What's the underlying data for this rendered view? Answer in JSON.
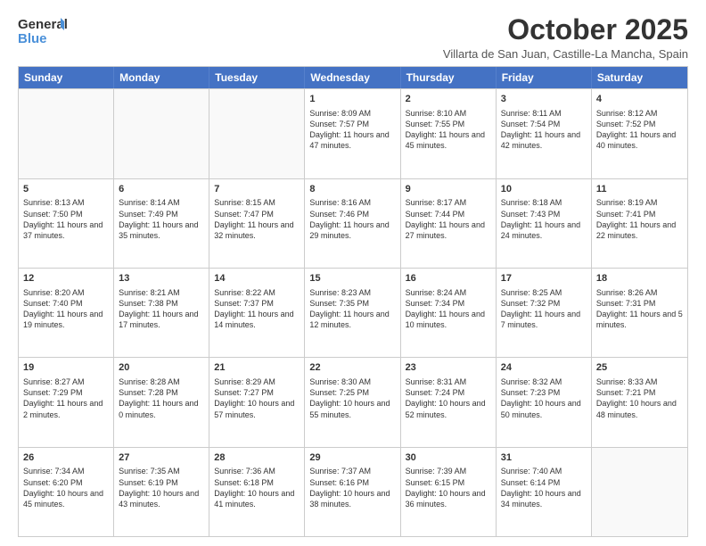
{
  "logo": {
    "line1": "General",
    "line2": "Blue"
  },
  "header": {
    "title": "October 2025",
    "location": "Villarta de San Juan, Castille-La Mancha, Spain"
  },
  "calendar": {
    "days": [
      "Sunday",
      "Monday",
      "Tuesday",
      "Wednesday",
      "Thursday",
      "Friday",
      "Saturday"
    ],
    "rows": [
      [
        {
          "day": "",
          "content": ""
        },
        {
          "day": "",
          "content": ""
        },
        {
          "day": "",
          "content": ""
        },
        {
          "day": "1",
          "content": "Sunrise: 8:09 AM\nSunset: 7:57 PM\nDaylight: 11 hours and 47 minutes."
        },
        {
          "day": "2",
          "content": "Sunrise: 8:10 AM\nSunset: 7:55 PM\nDaylight: 11 hours and 45 minutes."
        },
        {
          "day": "3",
          "content": "Sunrise: 8:11 AM\nSunset: 7:54 PM\nDaylight: 11 hours and 42 minutes."
        },
        {
          "day": "4",
          "content": "Sunrise: 8:12 AM\nSunset: 7:52 PM\nDaylight: 11 hours and 40 minutes."
        }
      ],
      [
        {
          "day": "5",
          "content": "Sunrise: 8:13 AM\nSunset: 7:50 PM\nDaylight: 11 hours and 37 minutes."
        },
        {
          "day": "6",
          "content": "Sunrise: 8:14 AM\nSunset: 7:49 PM\nDaylight: 11 hours and 35 minutes."
        },
        {
          "day": "7",
          "content": "Sunrise: 8:15 AM\nSunset: 7:47 PM\nDaylight: 11 hours and 32 minutes."
        },
        {
          "day": "8",
          "content": "Sunrise: 8:16 AM\nSunset: 7:46 PM\nDaylight: 11 hours and 29 minutes."
        },
        {
          "day": "9",
          "content": "Sunrise: 8:17 AM\nSunset: 7:44 PM\nDaylight: 11 hours and 27 minutes."
        },
        {
          "day": "10",
          "content": "Sunrise: 8:18 AM\nSunset: 7:43 PM\nDaylight: 11 hours and 24 minutes."
        },
        {
          "day": "11",
          "content": "Sunrise: 8:19 AM\nSunset: 7:41 PM\nDaylight: 11 hours and 22 minutes."
        }
      ],
      [
        {
          "day": "12",
          "content": "Sunrise: 8:20 AM\nSunset: 7:40 PM\nDaylight: 11 hours and 19 minutes."
        },
        {
          "day": "13",
          "content": "Sunrise: 8:21 AM\nSunset: 7:38 PM\nDaylight: 11 hours and 17 minutes."
        },
        {
          "day": "14",
          "content": "Sunrise: 8:22 AM\nSunset: 7:37 PM\nDaylight: 11 hours and 14 minutes."
        },
        {
          "day": "15",
          "content": "Sunrise: 8:23 AM\nSunset: 7:35 PM\nDaylight: 11 hours and 12 minutes."
        },
        {
          "day": "16",
          "content": "Sunrise: 8:24 AM\nSunset: 7:34 PM\nDaylight: 11 hours and 10 minutes."
        },
        {
          "day": "17",
          "content": "Sunrise: 8:25 AM\nSunset: 7:32 PM\nDaylight: 11 hours and 7 minutes."
        },
        {
          "day": "18",
          "content": "Sunrise: 8:26 AM\nSunset: 7:31 PM\nDaylight: 11 hours and 5 minutes."
        }
      ],
      [
        {
          "day": "19",
          "content": "Sunrise: 8:27 AM\nSunset: 7:29 PM\nDaylight: 11 hours and 2 minutes."
        },
        {
          "day": "20",
          "content": "Sunrise: 8:28 AM\nSunset: 7:28 PM\nDaylight: 11 hours and 0 minutes."
        },
        {
          "day": "21",
          "content": "Sunrise: 8:29 AM\nSunset: 7:27 PM\nDaylight: 10 hours and 57 minutes."
        },
        {
          "day": "22",
          "content": "Sunrise: 8:30 AM\nSunset: 7:25 PM\nDaylight: 10 hours and 55 minutes."
        },
        {
          "day": "23",
          "content": "Sunrise: 8:31 AM\nSunset: 7:24 PM\nDaylight: 10 hours and 52 minutes."
        },
        {
          "day": "24",
          "content": "Sunrise: 8:32 AM\nSunset: 7:23 PM\nDaylight: 10 hours and 50 minutes."
        },
        {
          "day": "25",
          "content": "Sunrise: 8:33 AM\nSunset: 7:21 PM\nDaylight: 10 hours and 48 minutes."
        }
      ],
      [
        {
          "day": "26",
          "content": "Sunrise: 7:34 AM\nSunset: 6:20 PM\nDaylight: 10 hours and 45 minutes."
        },
        {
          "day": "27",
          "content": "Sunrise: 7:35 AM\nSunset: 6:19 PM\nDaylight: 10 hours and 43 minutes."
        },
        {
          "day": "28",
          "content": "Sunrise: 7:36 AM\nSunset: 6:18 PM\nDaylight: 10 hours and 41 minutes."
        },
        {
          "day": "29",
          "content": "Sunrise: 7:37 AM\nSunset: 6:16 PM\nDaylight: 10 hours and 38 minutes."
        },
        {
          "day": "30",
          "content": "Sunrise: 7:39 AM\nSunset: 6:15 PM\nDaylight: 10 hours and 36 minutes."
        },
        {
          "day": "31",
          "content": "Sunrise: 7:40 AM\nSunset: 6:14 PM\nDaylight: 10 hours and 34 minutes."
        },
        {
          "day": "",
          "content": ""
        }
      ]
    ]
  }
}
